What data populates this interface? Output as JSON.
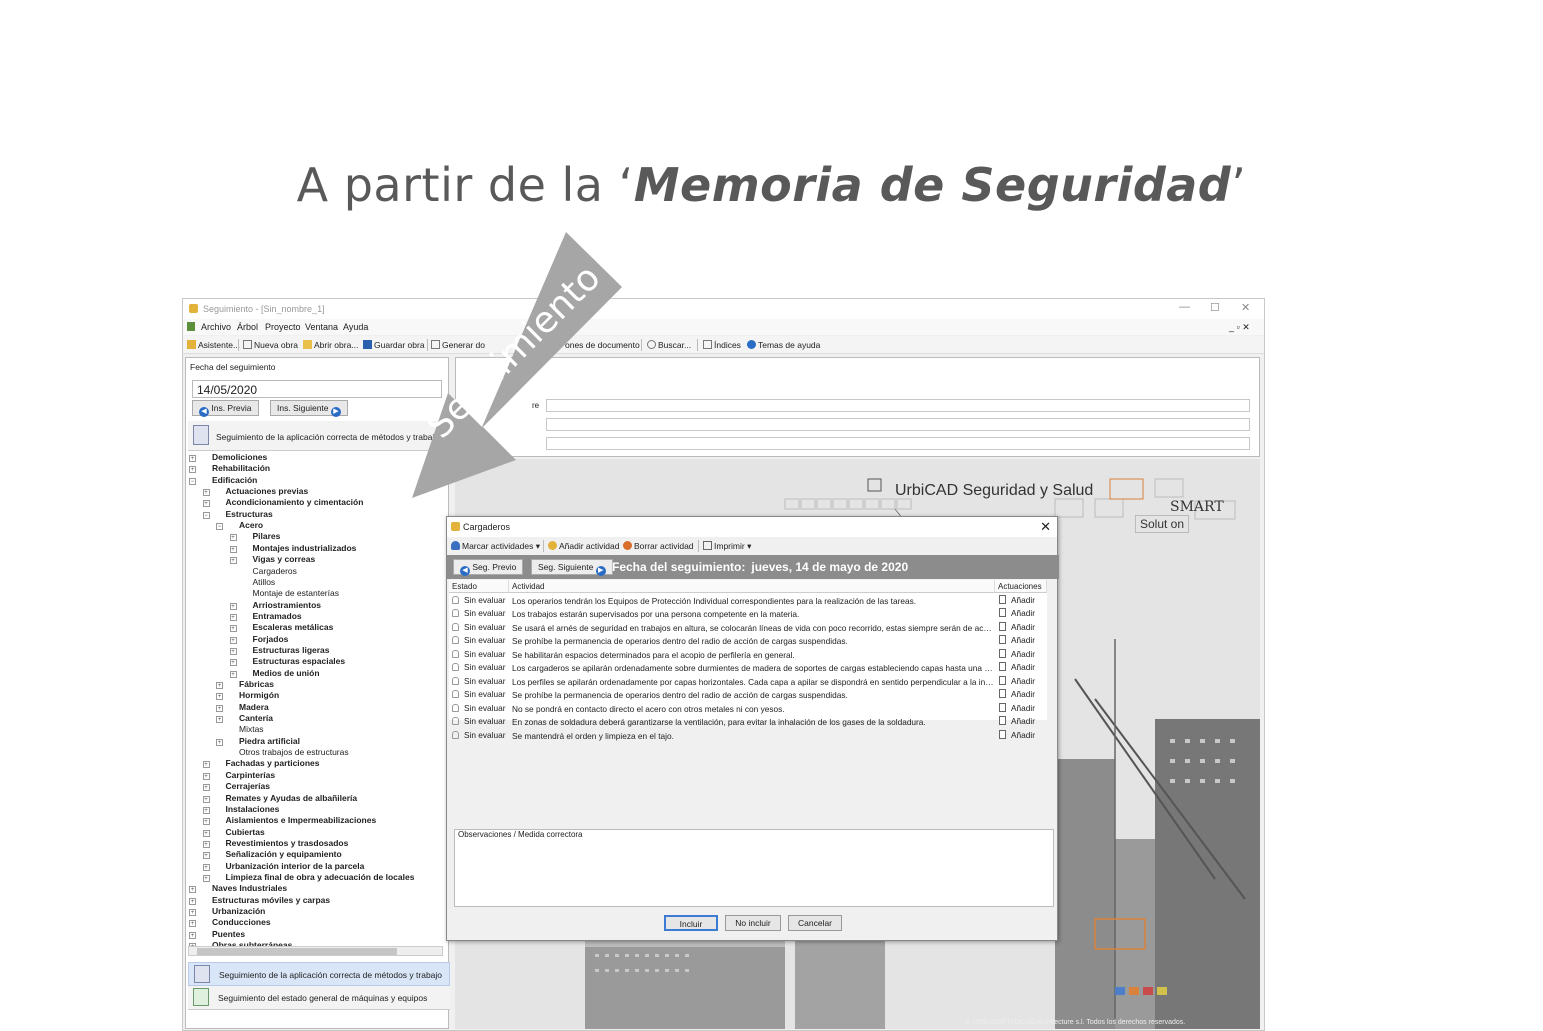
{
  "slide": {
    "headline_pre": "A partir de la ‘",
    "headline_em": "Memoria de Seguridad",
    "headline_post": "’",
    "arrow_label": "Seguimiento",
    "arrow_color": "#a6a6a6"
  },
  "window": {
    "title": "Seguimiento - [Sin_nombre_1]",
    "min": "—",
    "max": "☐",
    "close": "✕",
    "menu": [
      "Archivo",
      "Árbol",
      "Proyecto",
      "Ventana",
      "Ayuda"
    ],
    "menu_right": "_ ▫ ✕",
    "toolbar": {
      "asistente": "Asistente...",
      "nueva": "Nueva obra",
      "abrir": "Abrir obra...",
      "guardar": "Guardar obra",
      "generar": "Generar do",
      "opciones": "ones de documento",
      "buscar": "Buscar...",
      "indices": "Índices",
      "temas": "Temas de ayuda"
    }
  },
  "left_panel": {
    "date_label": "Fecha del seguimiento",
    "date_value": "14/05/2020",
    "prev_btn": "Ins. Previa",
    "next_btn": "Ins. Siguiente",
    "section_title": "Seguimiento de la aplicación correcta de métodos y trabajo",
    "tree": [
      {
        "label": "Demoliciones",
        "level": 0,
        "toggle": "+",
        "bold": true
      },
      {
        "label": "Rehabilitación",
        "level": 0,
        "toggle": "+",
        "bold": true
      },
      {
        "label": "Edificación",
        "level": 0,
        "toggle": "−",
        "bold": true
      },
      {
        "label": "Actuaciones previas",
        "level": 1,
        "toggle": "+",
        "bold": true
      },
      {
        "label": "Acondicionamiento y cimentación",
        "level": 1,
        "toggle": "+",
        "bold": true
      },
      {
        "label": "Estructuras",
        "level": 1,
        "toggle": "−",
        "bold": true
      },
      {
        "label": "Acero",
        "level": 2,
        "toggle": "−",
        "bold": true
      },
      {
        "label": "Pilares",
        "level": 3,
        "toggle": "+",
        "bold": true
      },
      {
        "label": "Montajes industrializados",
        "level": 3,
        "toggle": "+",
        "bold": true
      },
      {
        "label": "Vigas y correas",
        "level": 3,
        "toggle": "+",
        "bold": true
      },
      {
        "label": "Cargaderos",
        "level": 3,
        "toggle": "",
        "bold": false
      },
      {
        "label": "Atillos",
        "level": 3,
        "toggle": "",
        "bold": false
      },
      {
        "label": "Montaje de estanterías",
        "level": 3,
        "toggle": "",
        "bold": false
      },
      {
        "label": "Arriostramientos",
        "level": 3,
        "toggle": "+",
        "bold": true
      },
      {
        "label": "Entramados",
        "level": 3,
        "toggle": "+",
        "bold": true
      },
      {
        "label": "Escaleras metálicas",
        "level": 3,
        "toggle": "+",
        "bold": true
      },
      {
        "label": "Forjados",
        "level": 3,
        "toggle": "+",
        "bold": true
      },
      {
        "label": "Estructuras ligeras",
        "level": 3,
        "toggle": "+",
        "bold": true
      },
      {
        "label": "Estructuras espaciales",
        "level": 3,
        "toggle": "+",
        "bold": true
      },
      {
        "label": "Medios de unión",
        "level": 3,
        "toggle": "+",
        "bold": true
      },
      {
        "label": "Fábricas",
        "level": 2,
        "toggle": "+",
        "bold": true
      },
      {
        "label": "Hormigón",
        "level": 2,
        "toggle": "+",
        "bold": true
      },
      {
        "label": "Madera",
        "level": 2,
        "toggle": "+",
        "bold": true
      },
      {
        "label": "Cantería",
        "level": 2,
        "toggle": "+",
        "bold": true
      },
      {
        "label": "Mixtas",
        "level": 2,
        "toggle": "",
        "bold": false
      },
      {
        "label": "Piedra artificial",
        "level": 2,
        "toggle": "+",
        "bold": true
      },
      {
        "label": "Otros trabajos de estructuras",
        "level": 2,
        "toggle": "",
        "bold": false
      },
      {
        "label": "Fachadas y particiones",
        "level": 1,
        "toggle": "+",
        "bold": true
      },
      {
        "label": "Carpinterías",
        "level": 1,
        "toggle": "+",
        "bold": true
      },
      {
        "label": "Cerrajerías",
        "level": 1,
        "toggle": "+",
        "bold": true
      },
      {
        "label": "Remates y Ayudas de albañilería",
        "level": 1,
        "toggle": "+",
        "bold": true
      },
      {
        "label": "Instalaciones",
        "level": 1,
        "toggle": "+",
        "bold": true
      },
      {
        "label": "Aislamientos e Impermeabilizaciones",
        "level": 1,
        "toggle": "+",
        "bold": true
      },
      {
        "label": "Cubiertas",
        "level": 1,
        "toggle": "+",
        "bold": true
      },
      {
        "label": "Revestimientos y trasdosados",
        "level": 1,
        "toggle": "+",
        "bold": true
      },
      {
        "label": "Señalización y equipamiento",
        "level": 1,
        "toggle": "+",
        "bold": true
      },
      {
        "label": "Urbanización interior de la parcela",
        "level": 1,
        "toggle": "+",
        "bold": true
      },
      {
        "label": "Limpieza final de obra y adecuación de locales",
        "level": 1,
        "toggle": "+",
        "bold": true
      },
      {
        "label": "Naves Industriales",
        "level": 0,
        "toggle": "+",
        "bold": true
      },
      {
        "label": "Estructuras móviles y carpas",
        "level": 0,
        "toggle": "+",
        "bold": true
      },
      {
        "label": "Urbanización",
        "level": 0,
        "toggle": "+",
        "bold": true
      },
      {
        "label": "Conducciones",
        "level": 0,
        "toggle": "+",
        "bold": true
      },
      {
        "label": "Puentes",
        "level": 0,
        "toggle": "+",
        "bold": true
      },
      {
        "label": "Obras subterráneas",
        "level": 0,
        "toggle": "+",
        "bold": true
      }
    ],
    "bottom_items": [
      "Seguimiento de la aplicación correcta de métodos y trabajo",
      "Seguimiento del estado general de máquinas y equipos"
    ]
  },
  "right_panel": {
    "field_label_fragment": "re",
    "logo_title": "UrbiCAD Seguridad y Salud",
    "logo_smart": "SMART",
    "logo_solution": "Solut on",
    "copyright": "© 1990-2020 UrbiCAD architecture s.l.   Todos los derechos reservados."
  },
  "dialog": {
    "title": "Cargaderos",
    "close": "✕",
    "toolbar": {
      "marcar": "Marcar actividades",
      "anadir": "Añadir actividad",
      "borrar": "Borrar actividad",
      "imprimir": "Imprimir"
    },
    "prev_btn": "Seg. Previo",
    "next_btn": "Seg. Siguiente",
    "fecha_label": "Fecha del seguimiento:",
    "fecha_value": "jueves, 14 de mayo de 2020",
    "columns": [
      "Estado",
      "Actividad",
      "Actuaciones"
    ],
    "rows": [
      {
        "estado": "Sin evaluar",
        "actividad": "Los operarios tendrán los Equipos de Protección Individual correspondientes para la realización de las tareas.",
        "accion": "Añadir"
      },
      {
        "estado": "Sin evaluar",
        "actividad": "Los trabajos estarán supervisados por una persona competente en la materia.",
        "accion": "Añadir"
      },
      {
        "estado": "Sin evaluar",
        "actividad": "Se usará el arnés de seguridad en trabajos en altura, se colocarán líneas de vida con poco recorrido, estas siempre serán de acero.",
        "accion": "Añadir"
      },
      {
        "estado": "Sin evaluar",
        "actividad": "Se prohíbe la permanencia de operarios dentro del radio de acción de cargas suspendidas.",
        "accion": "Añadir"
      },
      {
        "estado": "Sin evaluar",
        "actividad": "Se habilitarán espacios determinados para el acopio de perfilería en general.",
        "accion": "Añadir"
      },
      {
        "estado": "Sin evaluar",
        "actividad": "Los cargaderos se apilarán ordenadamente  sobre durmientes de madera de soportes de cargas estableciendo capas hasta una altur...",
        "accion": "Añadir"
      },
      {
        "estado": "Sin evaluar",
        "actividad": "Los perfiles se apilarán ordenadamente por capas horizontales. Cada capa a apilar se dispondrá en sentido perpendicular a la inmedi...",
        "accion": "Añadir"
      },
      {
        "estado": "Sin evaluar",
        "actividad": "Se prohíbe la permanencia de operarios dentro del radio de acción de cargas suspendidas.",
        "accion": "Añadir"
      },
      {
        "estado": "Sin evaluar",
        "actividad": "No se pondrá en contacto directo el acero con otros metales ni con yesos.",
        "accion": "Añadir"
      },
      {
        "estado": "Sin evaluar",
        "actividad": "En zonas de soldadura deberá garantizarse la ventilación, para evitar la inhalación de los gases de la soldadura.",
        "accion": "Añadir"
      },
      {
        "estado": "Sin evaluar",
        "actividad": "Se mantendrá el orden y limpieza en el tajo.",
        "accion": "Añadir"
      }
    ],
    "observaciones_label": "Observaciones / Medida correctora",
    "buttons": {
      "incluir": "Incluir",
      "no_incluir": "No incluir",
      "cancelar": "Cancelar"
    }
  }
}
